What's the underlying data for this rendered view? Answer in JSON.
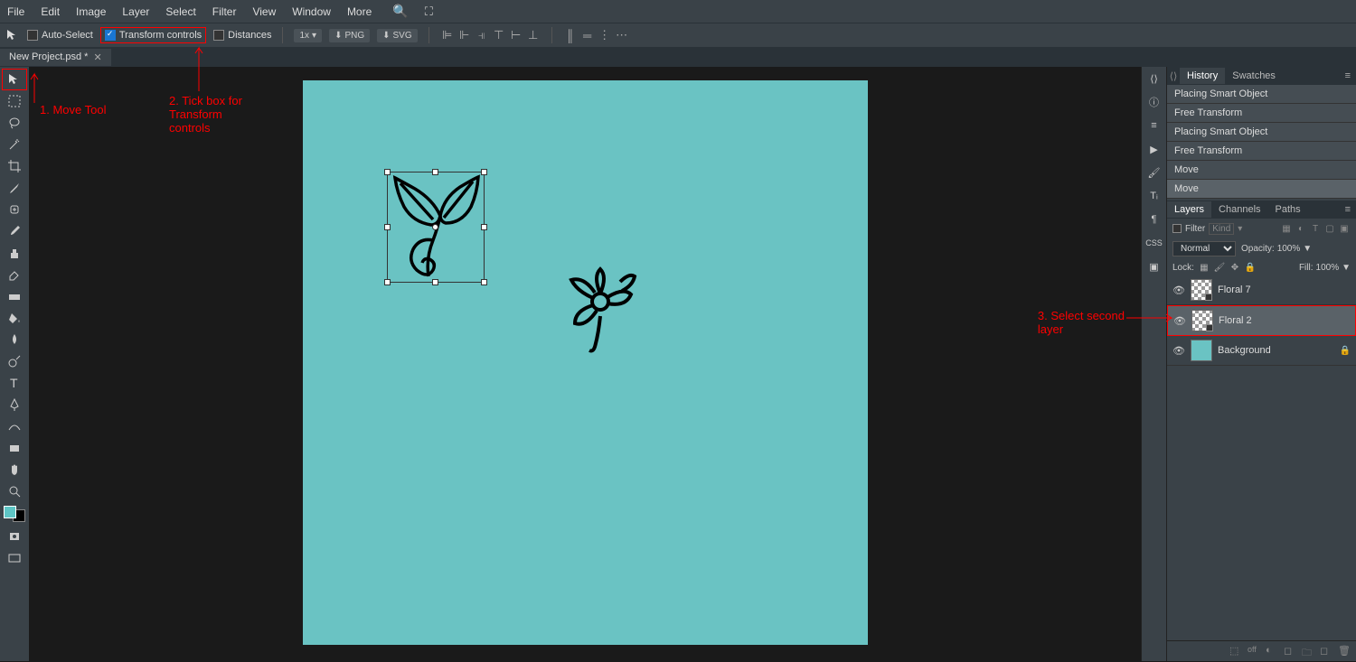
{
  "menu": {
    "items": [
      "File",
      "Edit",
      "Image",
      "Layer",
      "Select",
      "Filter",
      "View",
      "Window",
      "More"
    ]
  },
  "options_bar": {
    "auto_select": "Auto-Select",
    "transform_controls": "Transform controls",
    "distances": "Distances",
    "zoom": "1x",
    "png": "PNG",
    "svg": "SVG"
  },
  "tab": {
    "title": "New Project.psd *",
    "close": "✕"
  },
  "annotations": {
    "a1": "1. Move Tool",
    "a2": "2. Tick box for\nTransform\ncontrols",
    "a3": "3. Select second\nlayer"
  },
  "history_panel": {
    "tabs": [
      "History",
      "Swatches"
    ],
    "items": [
      "Placing Smart Object",
      "Free Transform",
      "Placing Smart Object",
      "Free Transform",
      "Move",
      "Move"
    ]
  },
  "layers_panel": {
    "tabs": [
      "Layers",
      "Channels",
      "Paths"
    ],
    "filter_label": "Filter",
    "filter_kind": "Kind",
    "blend_mode": "Normal",
    "opacity_label": "Opacity:",
    "opacity_value": "100%",
    "lock_label": "Lock:",
    "fill_label": "Fill:",
    "fill_value": "100%",
    "layers": [
      {
        "name": "Floral 7",
        "type": "smart"
      },
      {
        "name": "Floral 2",
        "type": "smart",
        "selected": true
      },
      {
        "name": "Background",
        "type": "bg",
        "locked": true
      }
    ]
  }
}
